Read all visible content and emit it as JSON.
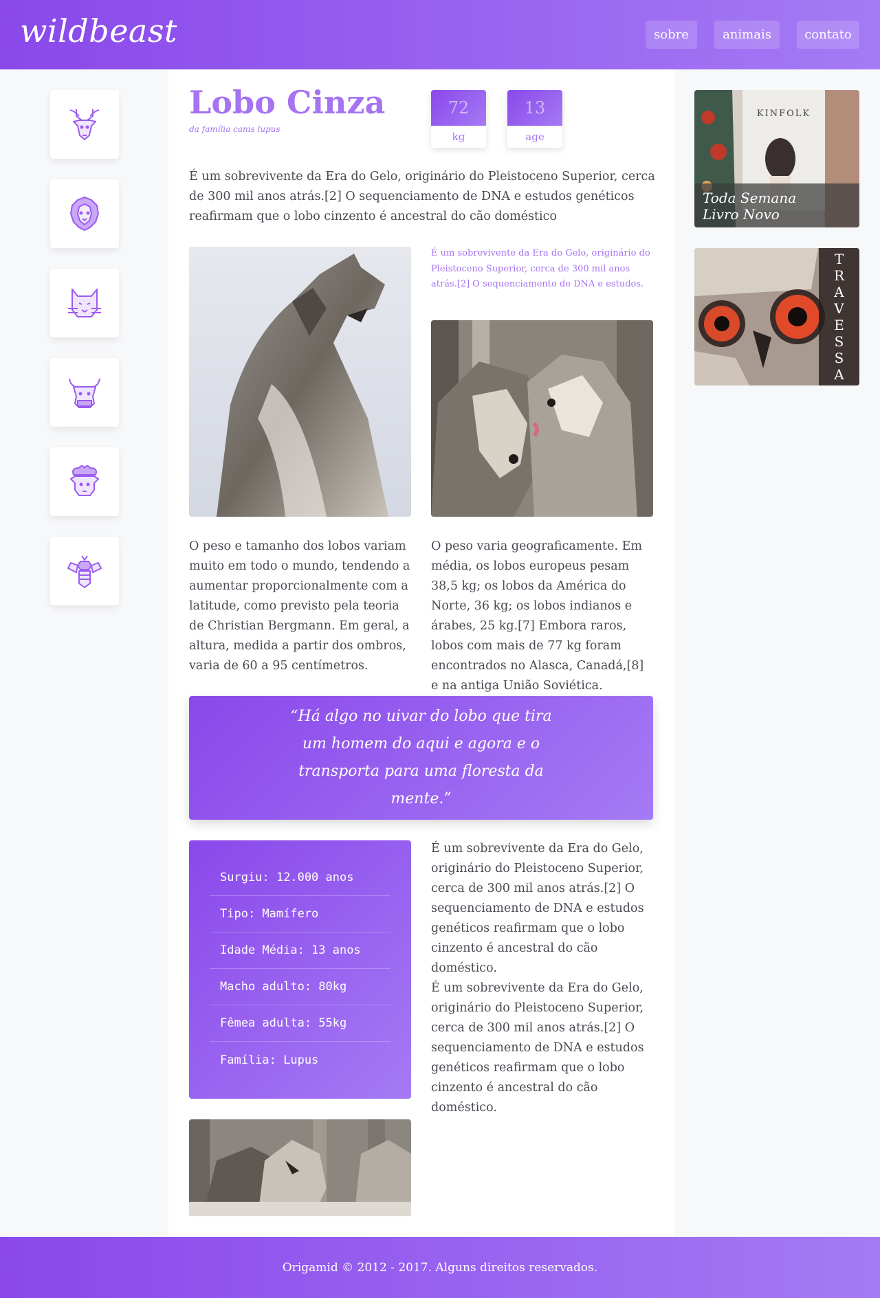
{
  "header": {
    "logo": "wildbeast",
    "nav": [
      "sobre",
      "animais",
      "contato"
    ]
  },
  "sidebar": {
    "icons": [
      "deer-icon",
      "lion-icon",
      "cat-icon",
      "bull-icon",
      "sheep-icon",
      "bee-icon"
    ]
  },
  "article": {
    "title": "Lobo Cinza",
    "subtitle": "da família canis lupus",
    "stats": [
      {
        "value": "72",
        "label": "kg"
      },
      {
        "value": "13",
        "label": "age"
      }
    ],
    "intro": "É um sobrevivente da Era do Gelo, originário do Pleistoceno Superior, cerca de 300 mil anos atrás.[2] O sequenciamento de DNA e estudos genéticos reafirmam que o lobo cinzento é ancestral do cão doméstico",
    "caption": "É um sobrevivente da Era do Gelo, originário do Pleistoceno Superior, cerca de 300 mil anos atrás.[2] O sequenciamento de DNA e estudos.",
    "para_left": "O peso e tamanho dos lobos variam muito em todo o mundo, tendendo a aumentar proporcionalmente com a latitude, como previsto pela teoria de Christian Bergmann. Em geral, a altura, medida a partir dos ombros, varia de 60 a 95 centímetros.",
    "para_right": "O peso varia geograficamente. Em média, os lobos europeus pesam 38,5 kg; os lobos da América do Norte, 36 kg; os lobos indianos e árabes, 25 kg.[7] Embora raros, lobos com mais de 77 kg foram encontrados no Alasca, Canadá,[8] e na antiga União Soviética.",
    "quote": "“Há algo no uivar do lobo que tira um homem do aqui e agora e o transporta para uma floresta da mente.”",
    "facts": [
      "Surgiu: 12.000 anos",
      "Tipo: Mamífero",
      "Idade Média: 13 anos",
      "Macho adulto: 80kg",
      "Fêmea adulta: 55kg",
      "Família: Lupus"
    ],
    "side_para_1": "É um sobrevivente da Era do Gelo, originário do Pleistoceno Superior, cerca de 300 mil anos atrás.[2] O sequenciamento de DNA e estudos genéticos reafirmam que o lobo cinzento é ancestral do cão doméstico.",
    "side_para_2": "É um sobrevivente da Era do Gelo, originário do Pleistoceno Superior, cerca de 300 mil anos atrás.[2] O sequenciamento de DNA e estudos genéticos reafirmam que o lobo cinzento é ancestral do cão doméstico."
  },
  "ads": {
    "ad1_caption_line1": "Toda Semana",
    "ad1_caption_line2": "Livro Novo",
    "ad1_book_label": "KINFOLK",
    "ad2_letters": [
      "T",
      "R",
      "A",
      "V",
      "E",
      "S",
      "S",
      "A"
    ]
  },
  "footer": {
    "text": "Origamid © 2012 - 2017. Alguns direitos reservados."
  },
  "colors": {
    "accent": "#a673f2",
    "gradient_start": "#8a48ea",
    "gradient_end": "#a57af5"
  }
}
